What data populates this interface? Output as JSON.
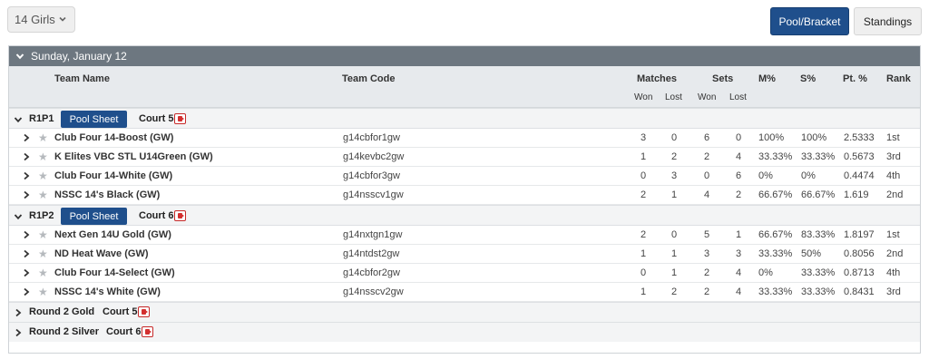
{
  "toolbar": {
    "division": "14 Girls",
    "pool_bracket_label": "Pool/Bracket",
    "standings_label": "Standings"
  },
  "day": {
    "label": "Sunday, January 12"
  },
  "columns": {
    "team_name": "Team Name",
    "team_code": "Team Code",
    "matches": "Matches",
    "sets": "Sets",
    "m_pct": "M%",
    "s_pct": "S%",
    "pt_pct": "Pt. %",
    "rank": "Rank",
    "won": "Won",
    "lost": "Lost"
  },
  "pools": [
    {
      "name": "R1P1",
      "sheet_label": "Pool Sheet",
      "court": "Court 5",
      "teams": [
        {
          "name": "Club Four 14-Boost (GW)",
          "code": "g14cbfor1gw",
          "mw": "3",
          "ml": "0",
          "sw": "6",
          "sl": "0",
          "mpct": "100%",
          "spct": "100%",
          "ptpct": "2.5333",
          "rank": "1st"
        },
        {
          "name": "K Elites VBC STL U14Green (GW)",
          "code": "g14kevbc2gw",
          "mw": "1",
          "ml": "2",
          "sw": "2",
          "sl": "4",
          "mpct": "33.33%",
          "spct": "33.33%",
          "ptpct": "0.5673",
          "rank": "3rd"
        },
        {
          "name": "Club Four 14-White (GW)",
          "code": "g14cbfor3gw",
          "mw": "0",
          "ml": "3",
          "sw": "0",
          "sl": "6",
          "mpct": "0%",
          "spct": "0%",
          "ptpct": "0.4474",
          "rank": "4th"
        },
        {
          "name": "NSSC 14's Black (GW)",
          "code": "g14nsscv1gw",
          "mw": "2",
          "ml": "1",
          "sw": "4",
          "sl": "2",
          "mpct": "66.67%",
          "spct": "66.67%",
          "ptpct": "1.619",
          "rank": "2nd"
        }
      ]
    },
    {
      "name": "R1P2",
      "sheet_label": "Pool Sheet",
      "court": "Court 6",
      "teams": [
        {
          "name": "Next Gen 14U Gold (GW)",
          "code": "g14nxtgn1gw",
          "mw": "2",
          "ml": "0",
          "sw": "5",
          "sl": "1",
          "mpct": "66.67%",
          "spct": "83.33%",
          "ptpct": "1.8197",
          "rank": "1st"
        },
        {
          "name": "ND Heat Wave (GW)",
          "code": "g14ntdst2gw",
          "mw": "1",
          "ml": "1",
          "sw": "3",
          "sl": "3",
          "mpct": "33.33%",
          "spct": "50%",
          "ptpct": "0.8056",
          "rank": "2nd"
        },
        {
          "name": "Club Four 14-Select (GW)",
          "code": "g14cbfor2gw",
          "mw": "0",
          "ml": "1",
          "sw": "2",
          "sl": "4",
          "mpct": "0%",
          "spct": "33.33%",
          "ptpct": "0.8713",
          "rank": "4th"
        },
        {
          "name": "NSSC 14's White (GW)",
          "code": "g14nsscv2gw",
          "mw": "1",
          "ml": "2",
          "sw": "2",
          "sl": "4",
          "mpct": "33.33%",
          "spct": "33.33%",
          "ptpct": "0.8431",
          "rank": "3rd"
        }
      ]
    }
  ],
  "rounds": [
    {
      "name": "Round 2 Gold",
      "court": "Court 5"
    },
    {
      "name": "Round 2 Silver",
      "court": "Court 6"
    }
  ],
  "icons": {
    "chevron_down": "chevron-down-icon",
    "chevron_right": "chevron-right-icon",
    "star": "star-icon",
    "video": "video-camera-icon"
  },
  "colors": {
    "primary": "#1f4f8c",
    "day_header": "#6d7780",
    "video_red": "#d32f2f"
  }
}
